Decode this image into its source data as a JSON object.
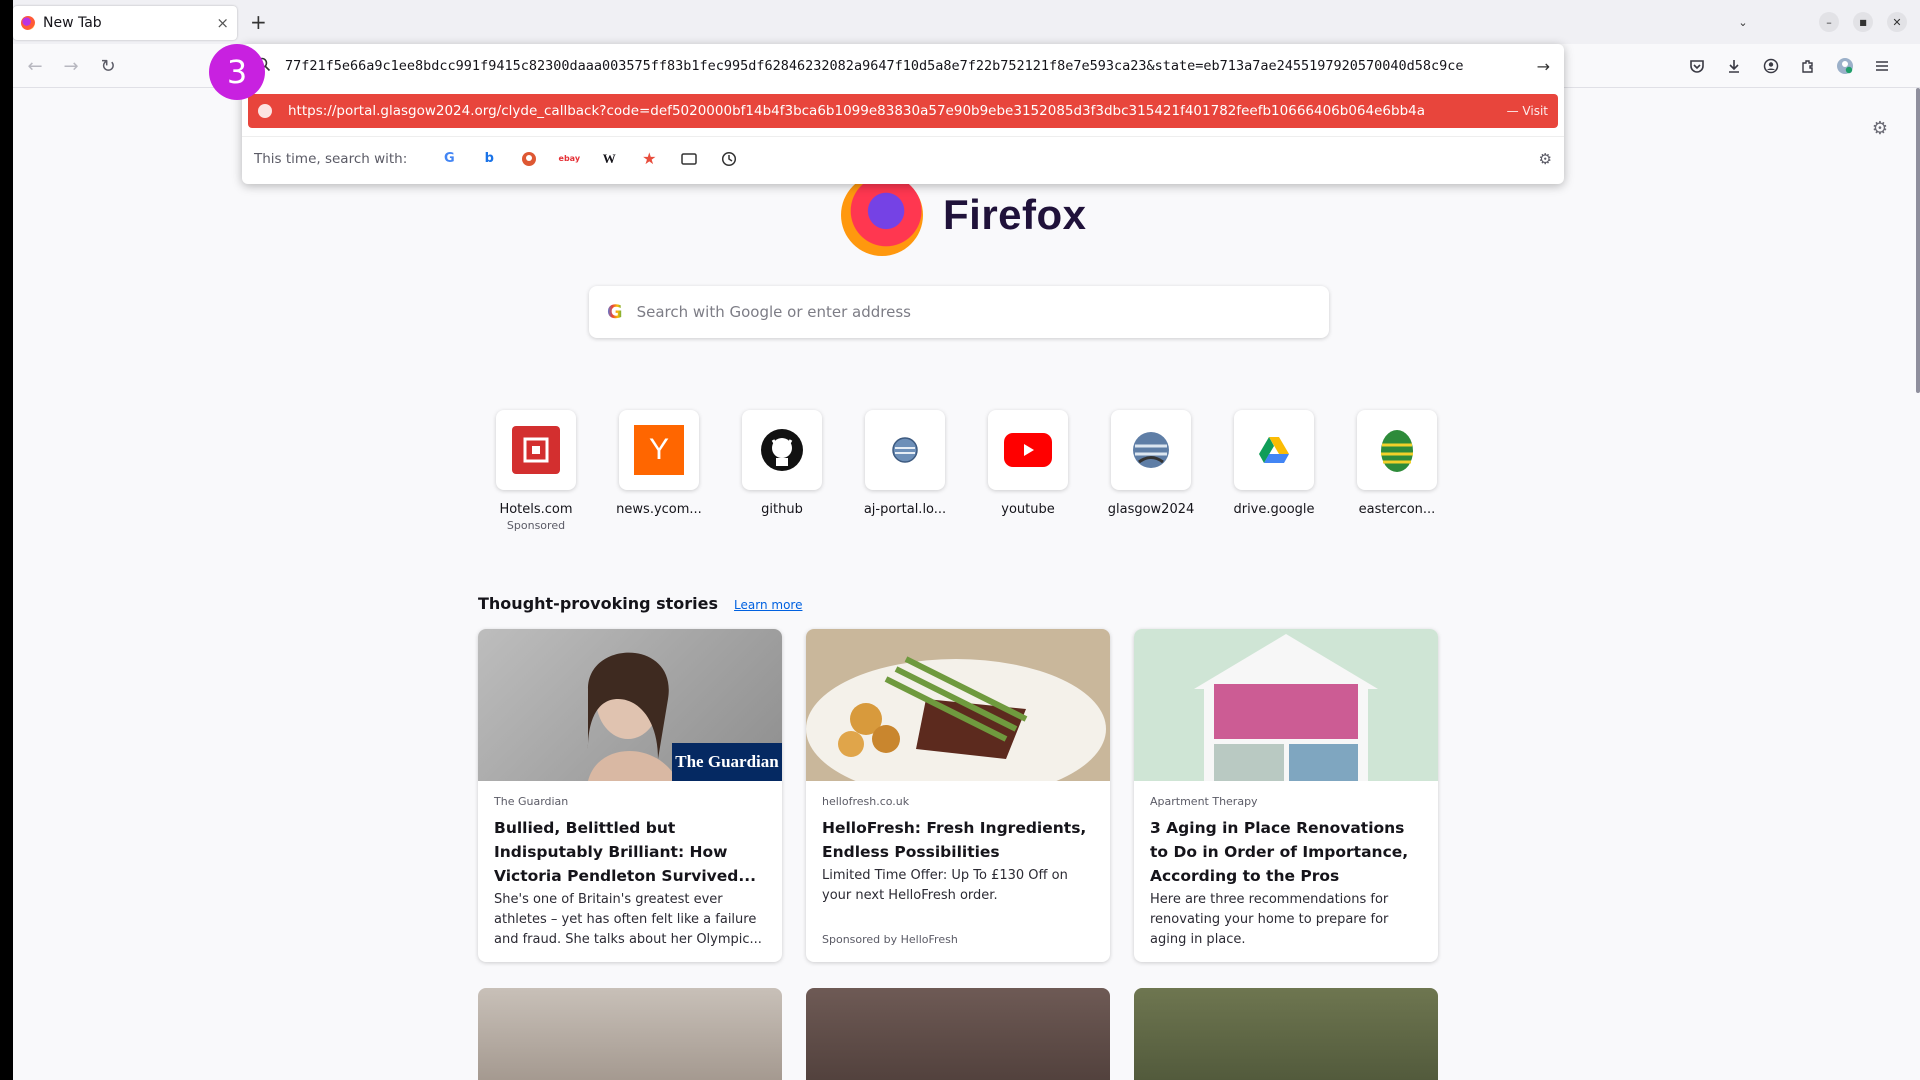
{
  "tab": {
    "title": "New Tab",
    "close": "×"
  },
  "newtab_symbol": "+",
  "window_controls": {
    "list": "⌄",
    "minimize": "–",
    "maximize": "■",
    "close": "✕"
  },
  "nav": {
    "back": "←",
    "forward": "→",
    "reload": "↻"
  },
  "toolbar_icons": [
    "pocket-icon",
    "download-icon",
    "account-icon",
    "extensions-icon",
    "profile-icon",
    "menu-icon"
  ],
  "urlbar": {
    "value": "77f21f5e66a9c1ee8bdcc991f9415c82300daaa003575ff83b1fec995df62846232082a9647f10d5a8e7f22b752121f8e7e593ca23&state=eb713a7ae2455197920570040d58c9ce",
    "suggestion_url": "https://portal.glasgow2024.org/clyde_callback?code=def5020000bf14b4f3bca6b1099e83830a57e90b9ebe3152085d3f3dbc315421f401782feefb10666406b064e6bb4a",
    "suggestion_action": "— Visit",
    "search_with_label": "This time, search with:",
    "engines": [
      "google",
      "bing",
      "duckduckgo",
      "ebay",
      "wikipedia",
      "bookmarks",
      "tabs",
      "history"
    ]
  },
  "step_badge": "3",
  "logo": {
    "wordmark": "Firefox"
  },
  "search": {
    "placeholder": "Search with Google or enter address",
    "g": "G"
  },
  "top_sites": [
    {
      "label": "Hotels.com",
      "sub": "Sponsored",
      "icon": "hotels-icon"
    },
    {
      "label": "news.ycom...",
      "icon": "ycombinator-icon",
      "glyph": "Y"
    },
    {
      "label": "github",
      "icon": "github-icon"
    },
    {
      "label": "aj-portal.lo...",
      "icon": "globe-icon"
    },
    {
      "label": "youtube",
      "icon": "youtube-icon"
    },
    {
      "label": "glasgow2024",
      "icon": "globe-icon"
    },
    {
      "label": "drive.google",
      "icon": "drive-icon"
    },
    {
      "label": "eastercon...",
      "icon": "egg-icon"
    }
  ],
  "stories": {
    "heading": "Thought-provoking stories",
    "learn_more": "Learn more",
    "cards": [
      {
        "source": "The Guardian",
        "title": "Bullied, Belittled but Indisputably Brilliant: How Victoria Pendleton Survived...",
        "excerpt": "She's one of Britain's greatest ever athletes – yet has often felt like a failure and fraud. She talks about her Olympic...",
        "img_label": "The Guardian"
      },
      {
        "source": "hellofresh.co.uk",
        "title": "HelloFresh: Fresh Ingredients, Endless Possibilities",
        "excerpt": "Limited Time Offer: Up To £130 Off on your next HelloFresh order.",
        "sponsored": "Sponsored by HelloFresh"
      },
      {
        "source": "Apartment Therapy",
        "title": "3 Aging in Place Renovations to Do in Order of Importance, According to the Pros",
        "excerpt": "Here are three recommendations for renovating your home to prepare for aging in place."
      }
    ]
  }
}
